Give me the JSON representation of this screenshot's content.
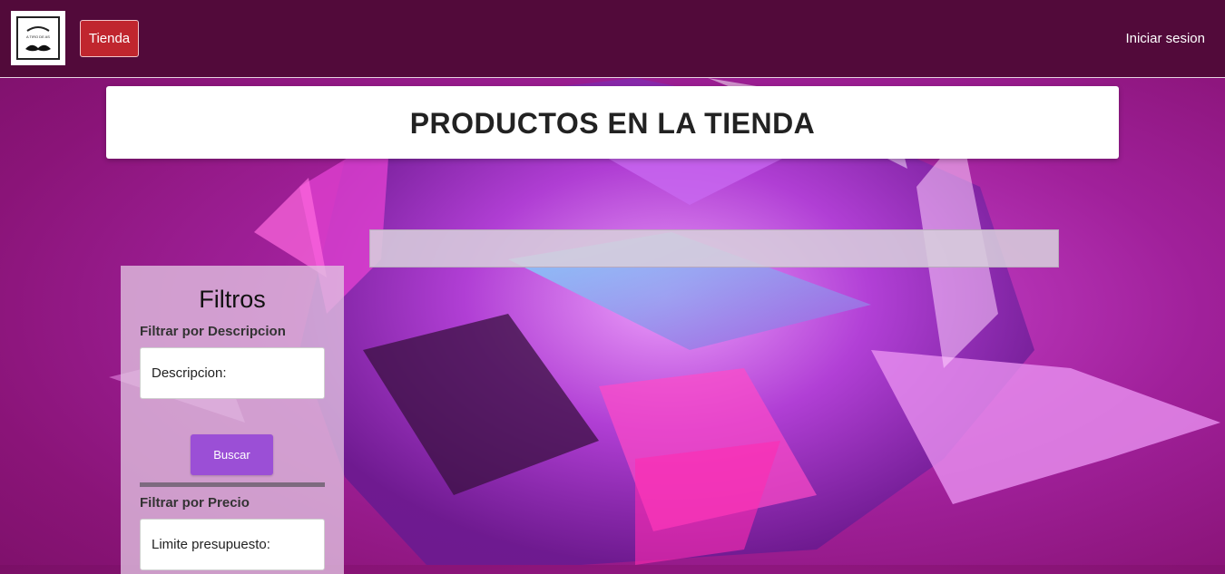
{
  "navbar": {
    "logo_text": "A TIRO DE AS",
    "store_button": "Tienda",
    "login_link": "Iniciar sesion"
  },
  "page": {
    "title": "PRODUCTOS EN LA TIENDA"
  },
  "search": {
    "value": ""
  },
  "filters": {
    "title": "Filtros",
    "description_label": "Filtrar por Descripcion",
    "description_placeholder": "Descripcion:",
    "search_button": "Buscar",
    "price_label": "Filtrar por Precio",
    "price_placeholder": "Limite presupuesto:"
  },
  "colors": {
    "navbar": "#520a3a",
    "store_button": "#c0262e",
    "search_button": "#9b4fd6"
  }
}
